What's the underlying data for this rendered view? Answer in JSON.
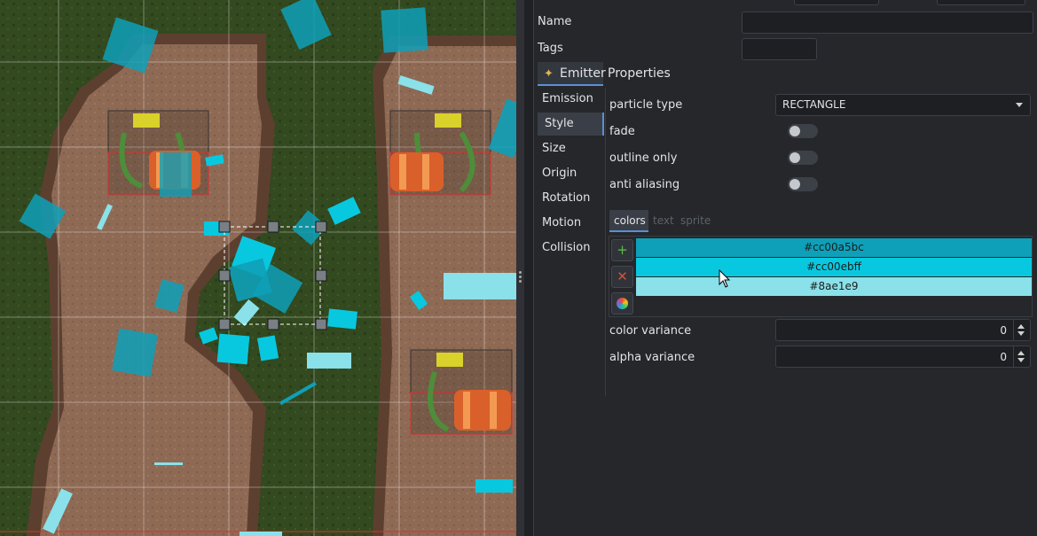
{
  "panel": {
    "name_label": "Name",
    "name_value": "",
    "tags_label": "Tags",
    "tags_value": "",
    "emitter_tab_label": "Emitter",
    "properties_heading": "Properties",
    "subtabs": [
      "Emission",
      "Style",
      "Size",
      "Origin",
      "Rotation",
      "Motion",
      "Collision"
    ],
    "active_subtab": "Style",
    "particle_type_label": "particle type",
    "particle_type_value": "RECTANGLE",
    "fade_label": "fade",
    "outline_only_label": "outline only",
    "anti_aliasing_label": "anti aliasing",
    "fade_on": false,
    "outline_only_on": false,
    "anti_aliasing_on": false,
    "inner_tabs": [
      "colors",
      "text",
      "sprite"
    ],
    "active_inner_tab": "colors",
    "colors": [
      {
        "label": "#cc00a5bc",
        "hex": "#0ea0b8"
      },
      {
        "label": "#cc00ebff",
        "hex": "#08c8e0"
      },
      {
        "label": "#8ae1e9",
        "hex": "#8ae1e9"
      }
    ],
    "color_variance_label": "color variance",
    "color_variance_value": "0",
    "alpha_variance_label": "alpha variance",
    "alpha_variance_value": "0",
    "add_icon": "plus-icon",
    "remove_icon": "cross-icon",
    "picker_icon": "color-wheel-icon"
  },
  "accent": "#5c8fd6"
}
